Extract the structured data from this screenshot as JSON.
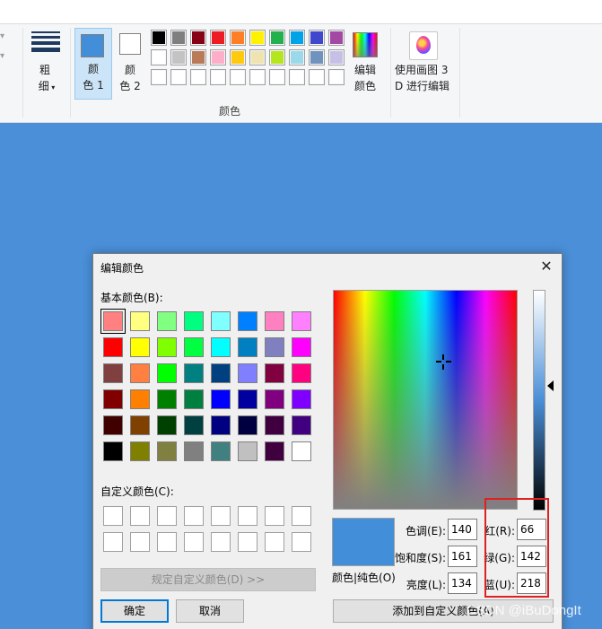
{
  "ribbon": {
    "size_label_line1": "粗",
    "size_label_line2": "细",
    "color1_line1": "颜",
    "color1_line2": "色 1",
    "color2_line1": "颜",
    "color2_line2": "色 2",
    "edit_colors_line1": "编辑",
    "edit_colors_line2": "颜色",
    "paint3d_line1": "使用画图 3",
    "paint3d_line2": "D 进行编辑",
    "colors_group_label": "颜色",
    "color1_value": "#428ed8",
    "color2_value": "#ffffff",
    "palette_row1": [
      "#000000",
      "#7f7f7f",
      "#880015",
      "#ed1c24",
      "#ff7f27",
      "#fff200",
      "#22b14c",
      "#00a2e8",
      "#3f48cc",
      "#a349a4"
    ],
    "palette_row2": [
      "#ffffff",
      "#c3c3c3",
      "#b97a57",
      "#ffaec9",
      "#ffc90e",
      "#efe4b0",
      "#b5e61d",
      "#99d9ea",
      "#7092be",
      "#c8bfe7"
    ],
    "palette_row3": [
      "#ffffff",
      "#ffffff",
      "#ffffff",
      "#ffffff",
      "#ffffff",
      "#ffffff",
      "#ffffff",
      "#ffffff",
      "#ffffff",
      "#ffffff"
    ]
  },
  "dialog": {
    "title": "编辑颜色",
    "close_glyph": "✕",
    "basic_colors_label": "基本颜色(B):",
    "basic_colors": [
      [
        "#ff8080",
        "#ffff80",
        "#80ff80",
        "#00ff80",
        "#80ffff",
        "#0080ff",
        "#ff80c0",
        "#ff80ff"
      ],
      [
        "#ff0000",
        "#ffff00",
        "#80ff00",
        "#00ff40",
        "#00ffff",
        "#0080c0",
        "#8080c0",
        "#ff00ff"
      ],
      [
        "#804040",
        "#ff8040",
        "#00ff00",
        "#008080",
        "#004080",
        "#8080ff",
        "#800040",
        "#ff0080"
      ],
      [
        "#800000",
        "#ff8000",
        "#008000",
        "#008040",
        "#0000ff",
        "#0000a0",
        "#800080",
        "#8000ff"
      ],
      [
        "#400000",
        "#804000",
        "#004000",
        "#004040",
        "#000080",
        "#000040",
        "#400040",
        "#400080"
      ],
      [
        "#000000",
        "#808000",
        "#808040",
        "#808080",
        "#408080",
        "#c0c0c0",
        "#400040",
        "#ffffff"
      ]
    ],
    "custom_colors_label": "自定义颜色(C):",
    "define_custom_button": "规定自定义颜色(D) >>",
    "ok_button": "确定",
    "cancel_button": "取消",
    "preview_label": "颜色|纯色(O)",
    "hue_label": "色调(E):",
    "hue_value": "140",
    "sat_label": "饱和度(S):",
    "sat_value": "161",
    "lum_label": "亮度(L):",
    "lum_value": "134",
    "red_label": "红(R):",
    "red_value": "66",
    "green_label": "绿(G):",
    "green_value": "142",
    "blue_label": "蓝(U):",
    "blue_value": "218",
    "add_custom_button": "添加到自定义颜色(A)",
    "preview_color": "#428ed8"
  },
  "watermark": "CSDN @iBuDongIt"
}
